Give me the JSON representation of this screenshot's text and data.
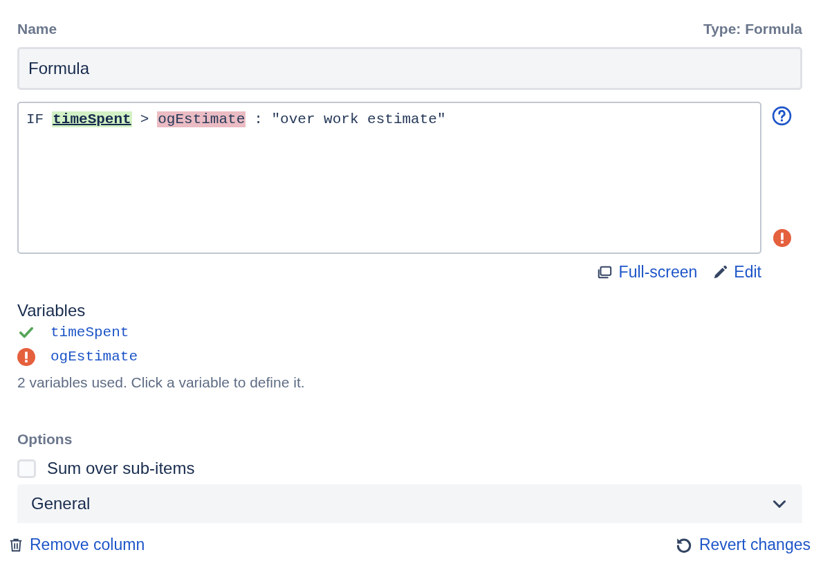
{
  "name_field": {
    "label": "Name",
    "type_label": "Type: Formula",
    "value": "Formula"
  },
  "formula": {
    "tokens": [
      {
        "kind": "text",
        "text": "IF"
      },
      {
        "kind": "variable",
        "text": "timeSpent",
        "defined": true
      },
      {
        "kind": "text",
        "text": ">"
      },
      {
        "kind": "variable",
        "text": "ogEstimate",
        "defined": false
      },
      {
        "kind": "text",
        "text": ": \"over work estimate\""
      }
    ],
    "has_error": true
  },
  "formula_actions": [
    {
      "kind": "fullscreen",
      "label": "Full-screen"
    },
    {
      "kind": "edit",
      "label": "Edit"
    }
  ],
  "variables": {
    "title": "Variables",
    "items": [
      {
        "name": "timeSpent",
        "defined": true
      },
      {
        "name": "ogEstimate",
        "defined": false
      }
    ],
    "note": "2 variables used. Click a variable to define it."
  },
  "options": {
    "title": "Options",
    "checkbox": {
      "label": "Sum over sub-items",
      "checked": false
    },
    "section": {
      "label": "General",
      "expanded": false
    }
  },
  "footer": {
    "remove": "Remove column",
    "revert": "Revert changes"
  }
}
